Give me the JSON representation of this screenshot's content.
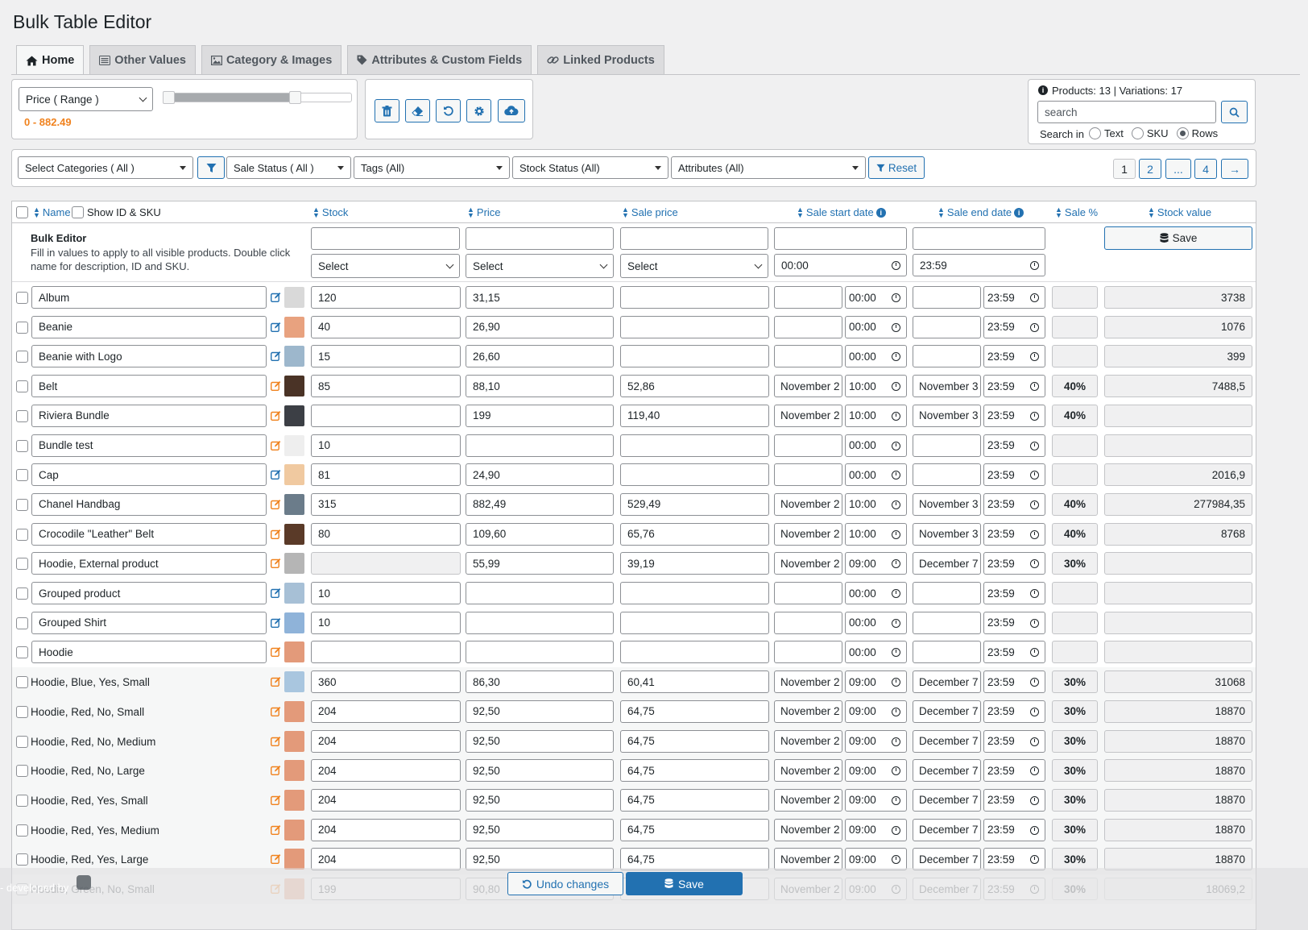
{
  "title": "Bulk Table Editor",
  "tabs": [
    {
      "label": "Home",
      "icon": "home-icon"
    },
    {
      "label": "Other Values",
      "icon": "list-icon"
    },
    {
      "label": "Category & Images",
      "icon": "image-icon"
    },
    {
      "label": "Attributes & Custom Fields",
      "icon": "tag-icon"
    },
    {
      "label": "Linked Products",
      "icon": "link-icon"
    }
  ],
  "price_filter": {
    "select_label": "Price ( Range )",
    "range_text": "0 - 882.49",
    "range_fraction": 0.7
  },
  "toolbar_icons": [
    "trash-icon",
    "eraser-icon",
    "undo-icon",
    "gear-icon",
    "cloud-upload-icon"
  ],
  "info": {
    "counts": "Products: 13 | Variations: 17",
    "search_placeholder": "search",
    "search_in_label": "Search in",
    "options": [
      "Text",
      "SKU",
      "Rows"
    ],
    "selected": "Rows"
  },
  "filters": {
    "categories": "Select Categories ( All )",
    "sale_status": "Sale Status ( All )",
    "tags": "Tags (All)",
    "stock_status": "Stock Status (All)",
    "attributes": "Attributes (All)",
    "reset": "Reset"
  },
  "pagination": [
    "1",
    "2",
    "...",
    "4",
    "→"
  ],
  "columns": {
    "name": "Name",
    "show_id_sku": "Show ID & SKU",
    "stock": "Stock",
    "price": "Price",
    "sale_price": "Sale price",
    "sale_start": "Sale start date",
    "sale_end": "Sale end date",
    "sale_pct": "Sale %",
    "stock_value": "Stock value"
  },
  "bulk": {
    "title": "Bulk Editor",
    "desc1": "Fill in values to apply to all visible products. Double click",
    "desc2": "name for description, ID and SKU.",
    "select": "Select",
    "start_time": "00:00",
    "end_time": "23:59",
    "save": "Save"
  },
  "rows": [
    {
      "name": "Album",
      "stock": "120",
      "price": "31,15",
      "sale": "",
      "sd": "",
      "st": "00:00",
      "ed": "",
      "et": "23:59",
      "pct": "",
      "val": "3738",
      "variation": false,
      "edit": "blue",
      "thumb": "#d9d9d9"
    },
    {
      "name": "Beanie",
      "stock": "40",
      "price": "26,90",
      "sale": "",
      "sd": "",
      "st": "00:00",
      "ed": "",
      "et": "23:59",
      "pct": "",
      "val": "1076",
      "variation": false,
      "edit": "blue",
      "thumb": "#e8a27f"
    },
    {
      "name": "Beanie with Logo",
      "stock": "15",
      "price": "26,60",
      "sale": "",
      "sd": "",
      "st": "00:00",
      "ed": "",
      "et": "23:59",
      "pct": "",
      "val": "399",
      "variation": false,
      "edit": "blue",
      "thumb": "#9db7cc"
    },
    {
      "name": "Belt",
      "stock": "85",
      "price": "88,10",
      "sale": "52,86",
      "sd": "November 2",
      "st": "10:00",
      "ed": "November 3",
      "et": "23:59",
      "pct": "40%",
      "val": "7488,5",
      "variation": false,
      "edit": "orange",
      "thumb": "#4a3326"
    },
    {
      "name": "Riviera Bundle",
      "stock": "",
      "price": "199",
      "sale": "119,40",
      "sd": "November 2",
      "st": "10:00",
      "ed": "November 3",
      "et": "23:59",
      "pct": "40%",
      "val": "",
      "variation": false,
      "edit": "orange",
      "thumb": "#3c3f45"
    },
    {
      "name": "Bundle test",
      "stock": "10",
      "price": "",
      "sale": "",
      "sd": "",
      "st": "00:00",
      "ed": "",
      "et": "23:59",
      "pct": "",
      "val": "",
      "variation": false,
      "edit": "orange",
      "thumb": "#eeeeee"
    },
    {
      "name": "Cap",
      "stock": "81",
      "price": "24,90",
      "sale": "",
      "sd": "",
      "st": "00:00",
      "ed": "",
      "et": "23:59",
      "pct": "",
      "val": "2016,9",
      "variation": false,
      "edit": "blue",
      "thumb": "#f0c9a0"
    },
    {
      "name": "Chanel Handbag",
      "stock": "315",
      "price": "882,49",
      "sale": "529,49",
      "sd": "November 2",
      "st": "10:00",
      "ed": "November 3",
      "et": "23:59",
      "pct": "40%",
      "val": "277984,35",
      "variation": false,
      "edit": "orange",
      "thumb": "#6b7c8a"
    },
    {
      "name": "Crocodile \"Leather\" Belt",
      "stock": "80",
      "price": "109,60",
      "sale": "65,76",
      "sd": "November 2",
      "st": "10:00",
      "ed": "November 3",
      "et": "23:59",
      "pct": "40%",
      "val": "8768",
      "variation": false,
      "edit": "orange",
      "thumb": "#5a3a28"
    },
    {
      "name": "Hoodie, External product",
      "stock": "",
      "price": "55,99",
      "sale": "39,19",
      "sd": "November 2",
      "st": "09:00",
      "ed": "December 7",
      "et": "23:59",
      "pct": "30%",
      "val": "",
      "variation": false,
      "edit": "orange",
      "thumb": "#b5b5b5",
      "stock_disabled": true
    },
    {
      "name": "Grouped product",
      "stock": "10",
      "price": "",
      "sale": "",
      "sd": "",
      "st": "00:00",
      "ed": "",
      "et": "23:59",
      "pct": "",
      "val": "",
      "variation": false,
      "edit": "blue",
      "thumb": "#a7c0d6"
    },
    {
      "name": "Grouped Shirt",
      "stock": "10",
      "price": "",
      "sale": "",
      "sd": "",
      "st": "00:00",
      "ed": "",
      "et": "23:59",
      "pct": "",
      "val": "",
      "variation": false,
      "edit": "blue",
      "thumb": "#8fb3d9"
    },
    {
      "name": "Hoodie",
      "stock": "",
      "price": "",
      "sale": "",
      "sd": "",
      "st": "00:00",
      "ed": "",
      "et": "23:59",
      "pct": "",
      "val": "",
      "variation": false,
      "edit": "orange",
      "thumb": "#e39a7a"
    },
    {
      "name": "Hoodie, Blue, Yes, Small",
      "stock": "360",
      "price": "86,30",
      "sale": "60,41",
      "sd": "November 2",
      "st": "09:00",
      "ed": "December 7",
      "et": "23:59",
      "pct": "30%",
      "val": "31068",
      "variation": true,
      "edit": "orange",
      "thumb": "#a9c6df"
    },
    {
      "name": "Hoodie, Red, No, Small",
      "stock": "204",
      "price": "92,50",
      "sale": "64,75",
      "sd": "November 2",
      "st": "09:00",
      "ed": "December 7",
      "et": "23:59",
      "pct": "30%",
      "val": "18870",
      "variation": true,
      "edit": "orange",
      "thumb": "#e39a7a"
    },
    {
      "name": "Hoodie, Red, No, Medium",
      "stock": "204",
      "price": "92,50",
      "sale": "64,75",
      "sd": "November 2",
      "st": "09:00",
      "ed": "December 7",
      "et": "23:59",
      "pct": "30%",
      "val": "18870",
      "variation": true,
      "edit": "orange",
      "thumb": "#e39a7a"
    },
    {
      "name": "Hoodie, Red, No, Large",
      "stock": "204",
      "price": "92,50",
      "sale": "64,75",
      "sd": "November 2",
      "st": "09:00",
      "ed": "December 7",
      "et": "23:59",
      "pct": "30%",
      "val": "18870",
      "variation": true,
      "edit": "orange",
      "thumb": "#e39a7a"
    },
    {
      "name": "Hoodie, Red, Yes, Small",
      "stock": "204",
      "price": "92,50",
      "sale": "64,75",
      "sd": "November 2",
      "st": "09:00",
      "ed": "December 7",
      "et": "23:59",
      "pct": "30%",
      "val": "18870",
      "variation": true,
      "edit": "orange",
      "thumb": "#e39a7a"
    },
    {
      "name": "Hoodie, Red, Yes, Medium",
      "stock": "204",
      "price": "92,50",
      "sale": "64,75",
      "sd": "November 2",
      "st": "09:00",
      "ed": "December 7",
      "et": "23:59",
      "pct": "30%",
      "val": "18870",
      "variation": true,
      "edit": "orange",
      "thumb": "#e39a7a"
    },
    {
      "name": "Hoodie, Red, Yes, Large",
      "stock": "204",
      "price": "92,50",
      "sale": "64,75",
      "sd": "November 2",
      "st": "09:00",
      "ed": "December 7",
      "et": "23:59",
      "pct": "30%",
      "val": "18870",
      "variation": true,
      "edit": "orange",
      "thumb": "#e39a7a"
    },
    {
      "name": "Hoodie, Green, No, Small",
      "stock": "199",
      "price": "90,80",
      "sale": "",
      "sd": "November 2",
      "st": "09:00",
      "ed": "December 7",
      "et": "23:59",
      "pct": "30%",
      "val": "18069,2",
      "variation": true,
      "edit": "orange",
      "thumb": "#e39a7a",
      "faded": true
    }
  ],
  "bottom": {
    "undo": "Undo changes",
    "save": "Save",
    "developed_by": "- developed by"
  },
  "colors": {
    "accent": "#2271b1",
    "orange": "#f0821e",
    "border": "#8c8f94"
  }
}
